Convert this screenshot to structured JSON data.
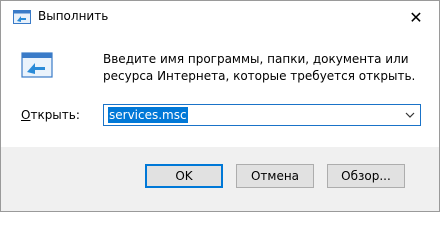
{
  "window": {
    "title": "Выполнить",
    "close_glyph": "✕"
  },
  "dialog": {
    "description": "Введите имя программы, папки, документа или ресурса Интернета, которые требуется открыть.",
    "open_label_accel": "О",
    "open_label_rest": "ткрыть:",
    "input_value": "services.msc"
  },
  "buttons": {
    "ok": "OK",
    "cancel": "Отмена",
    "browse": "Обзор..."
  },
  "icons": {
    "title": "run-icon",
    "large": "run-program-icon",
    "dropdown": "chevron-down-icon",
    "close": "close-icon"
  },
  "colors": {
    "accent": "#0078d7",
    "footer_bg": "#f0f0f0",
    "button_bg": "#e1e1e1"
  }
}
